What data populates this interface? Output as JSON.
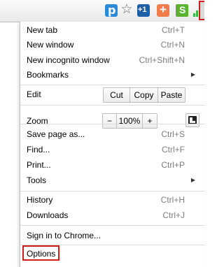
{
  "toolbar": {
    "icons": {
      "p_badge": "p",
      "plus_one": "+1",
      "addthis": "+",
      "s_badge": "S"
    }
  },
  "menu": {
    "new_tab": {
      "label": "New tab",
      "shortcut": "Ctrl+T"
    },
    "new_window": {
      "label": "New window",
      "shortcut": "Ctrl+N"
    },
    "new_incognito": {
      "label": "New incognito window",
      "shortcut": "Ctrl+Shift+N"
    },
    "bookmarks": {
      "label": "Bookmarks"
    },
    "edit": {
      "label": "Edit",
      "cut": "Cut",
      "copy": "Copy",
      "paste": "Paste"
    },
    "zoom": {
      "label": "Zoom",
      "minus": "−",
      "value": "100%",
      "plus": "+"
    },
    "save_page": {
      "label": "Save page as...",
      "shortcut": "Ctrl+S"
    },
    "find": {
      "label": "Find...",
      "shortcut": "Ctrl+F"
    },
    "print": {
      "label": "Print...",
      "shortcut": "Ctrl+P"
    },
    "tools": {
      "label": "Tools"
    },
    "history": {
      "label": "History",
      "shortcut": "Ctrl+H"
    },
    "downloads": {
      "label": "Downloads",
      "shortcut": "Ctrl+J"
    },
    "sign_in": {
      "label": "Sign in to Chrome..."
    },
    "options": {
      "label": "Options"
    }
  },
  "colors": {
    "highlight": "#d21b1b",
    "shortcut_text": "#7d7d7d"
  }
}
